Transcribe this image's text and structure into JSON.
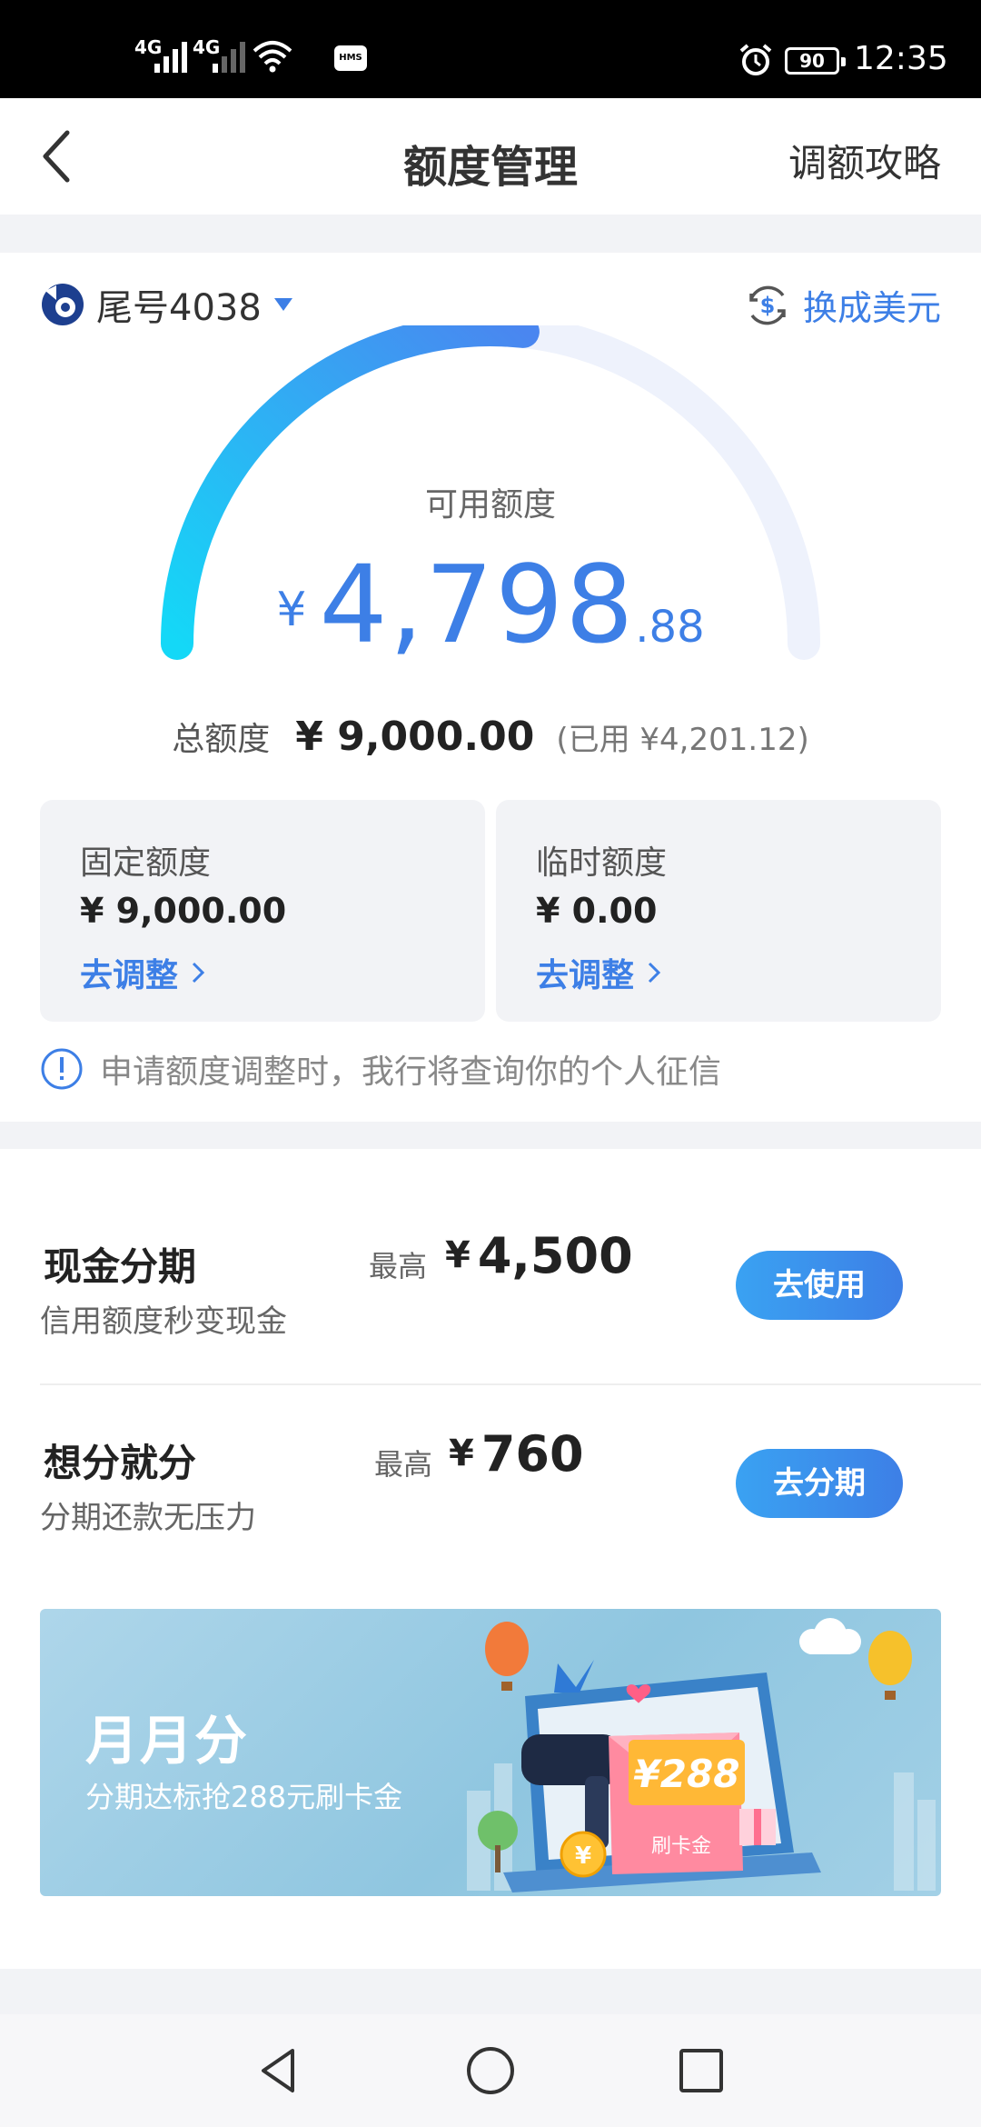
{
  "status_bar": {
    "sim1": "4G",
    "sim2": "4G",
    "hms": "HMS",
    "battery": "90",
    "time": "12:35",
    "icons": [
      "signal-icon",
      "signal-icon",
      "wifi-icon",
      "hms-icon",
      "alarm-icon",
      "battery-icon"
    ]
  },
  "header": {
    "title": "额度管理",
    "right_link": "调额攻略"
  },
  "card": {
    "label": "尾号4038",
    "currency_switch": "换成美元",
    "available_label": "可用额度",
    "available_yen": "¥",
    "available_int": "4,798",
    "available_dec": ".88",
    "usage_ratio": 0.5332,
    "total_label": "总额度",
    "total_value": "¥ 9,000.00",
    "used_text": "(已用 ¥4,201.12)"
  },
  "limits": [
    {
      "title": "固定额度",
      "value": "¥ 9,000.00",
      "action": "去调整"
    },
    {
      "title": "临时额度",
      "value": "¥ 0.00",
      "action": "去调整"
    }
  ],
  "notice": "申请额度调整时，我行将查询你的个人征信",
  "installments": [
    {
      "title": "现金分期",
      "subtitle": "信用额度秒变现金",
      "max_label": "最高",
      "yen": "¥",
      "amount": "4,500",
      "button": "去使用"
    },
    {
      "title": "想分就分",
      "subtitle": "分期还款无压力",
      "max_label": "最高",
      "yen": "¥",
      "amount": "760",
      "button": "去分期"
    }
  ],
  "banner": {
    "title": "月月分",
    "subtitle": "分期达标抢288元刷卡金",
    "envelope_amount": "¥288",
    "envelope_label": "刷卡金",
    "coin": "¥"
  },
  "colors": {
    "accent": "#3d7fe6",
    "gauge_start": "#14d8f7",
    "gauge_end": "#4a86f0",
    "gauge_track": "#eef2fc"
  }
}
